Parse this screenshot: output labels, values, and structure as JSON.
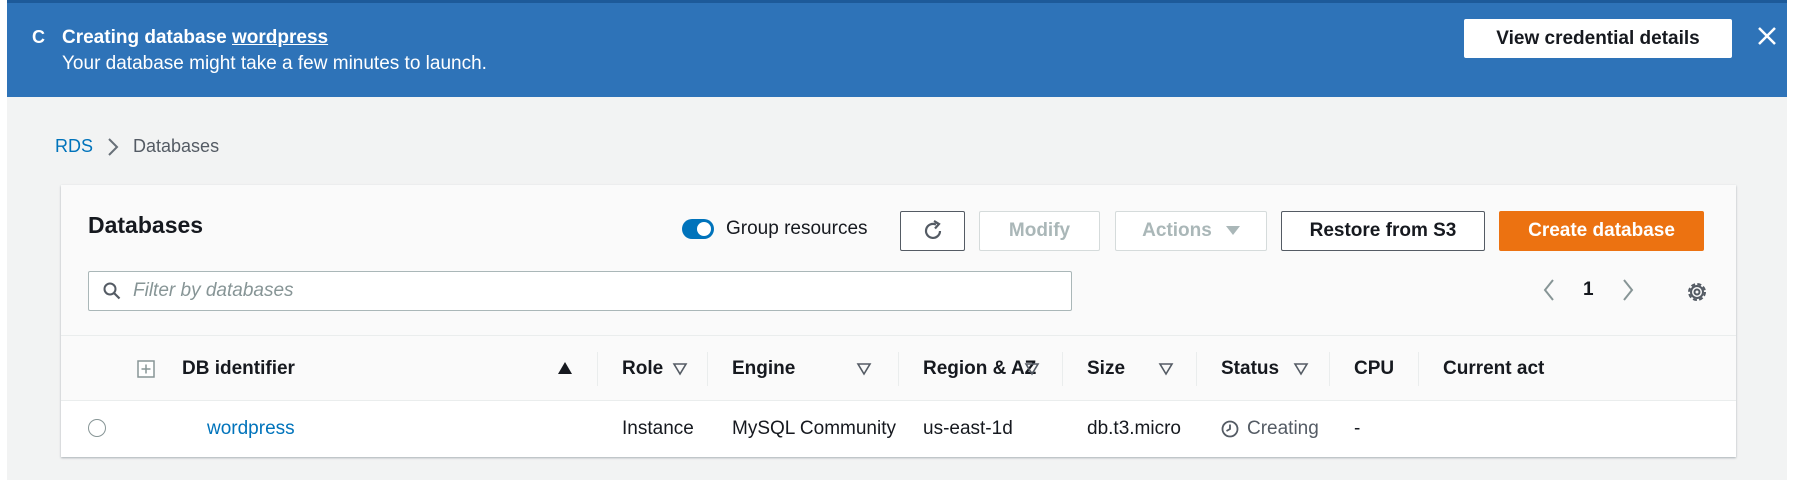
{
  "banner": {
    "title_prefix": "Creating database",
    "title_link": "wordpress",
    "subtitle": "Your database might take a few minutes to launch.",
    "credentials_button": "View credential details",
    "spinner_glyph": "C"
  },
  "breadcrumb": {
    "root": "RDS",
    "current": "Databases"
  },
  "panel": {
    "title": "Databases",
    "group_resources_label": "Group resources",
    "group_resources_on": true,
    "buttons": {
      "modify": "Modify",
      "actions": "Actions",
      "restore": "Restore from S3",
      "create": "Create database"
    },
    "filter_placeholder": "Filter by databases",
    "page_number": "1"
  },
  "table": {
    "columns": {
      "identifier": "DB identifier",
      "role": "Role",
      "engine": "Engine",
      "region": "Region & AZ",
      "size": "Size",
      "status": "Status",
      "cpu": "CPU",
      "activity": "Current act"
    },
    "rows": [
      {
        "identifier": "wordpress",
        "role": "Instance",
        "engine": "MySQL Community",
        "region": "us-east-1d",
        "size": "db.t3.micro",
        "status": "Creating",
        "cpu": "-"
      }
    ]
  },
  "colors": {
    "banner": "#2e73b8",
    "primary": "#ec7211",
    "link": "#0073bb"
  }
}
